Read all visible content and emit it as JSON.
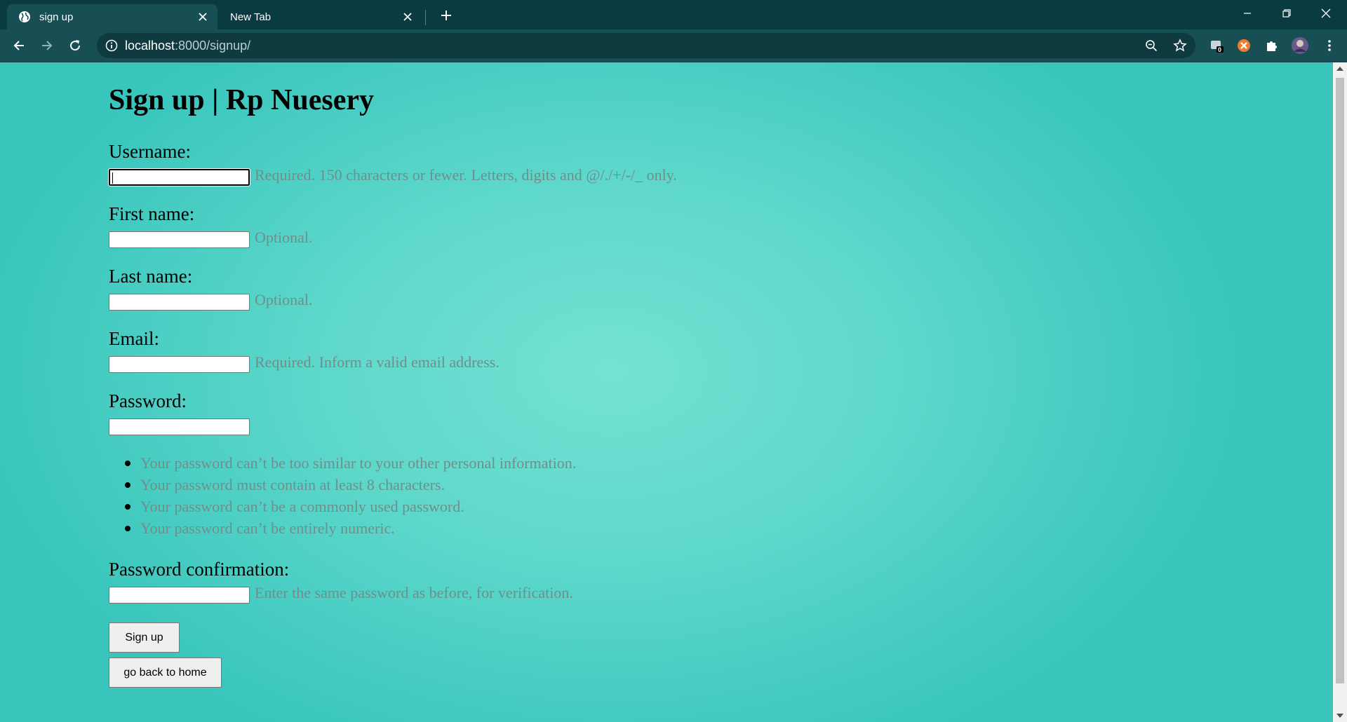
{
  "browser": {
    "tabs": [
      {
        "title": "sign up",
        "active": true
      },
      {
        "title": "New Tab",
        "active": false
      }
    ],
    "url_host": "localhost",
    "url_rest": ":8000/signup/",
    "extension_badge": "0"
  },
  "page": {
    "title": "Sign up | Rp Nuesery",
    "fields": {
      "username": {
        "label": "Username:",
        "help": "Required. 150 characters or fewer. Letters, digits and @/./+/-/_ only.",
        "value": ""
      },
      "first_name": {
        "label": "First name:",
        "help": "Optional.",
        "value": ""
      },
      "last_name": {
        "label": "Last name:",
        "help": "Optional.",
        "value": ""
      },
      "email": {
        "label": "Email:",
        "help": "Required. Inform a valid email address.",
        "value": ""
      },
      "password": {
        "label": "Password:",
        "value": ""
      },
      "password_confirmation": {
        "label": "Password confirmation:",
        "help": "Enter the same password as before, for verification.",
        "value": ""
      }
    },
    "password_rules": [
      "Your password can’t be too similar to your other personal information.",
      "Your password must contain at least 8 characters.",
      "Your password can’t be a commonly used password.",
      "Your password can’t be entirely numeric."
    ],
    "buttons": {
      "signup": "Sign up",
      "home": "go back to home"
    }
  }
}
